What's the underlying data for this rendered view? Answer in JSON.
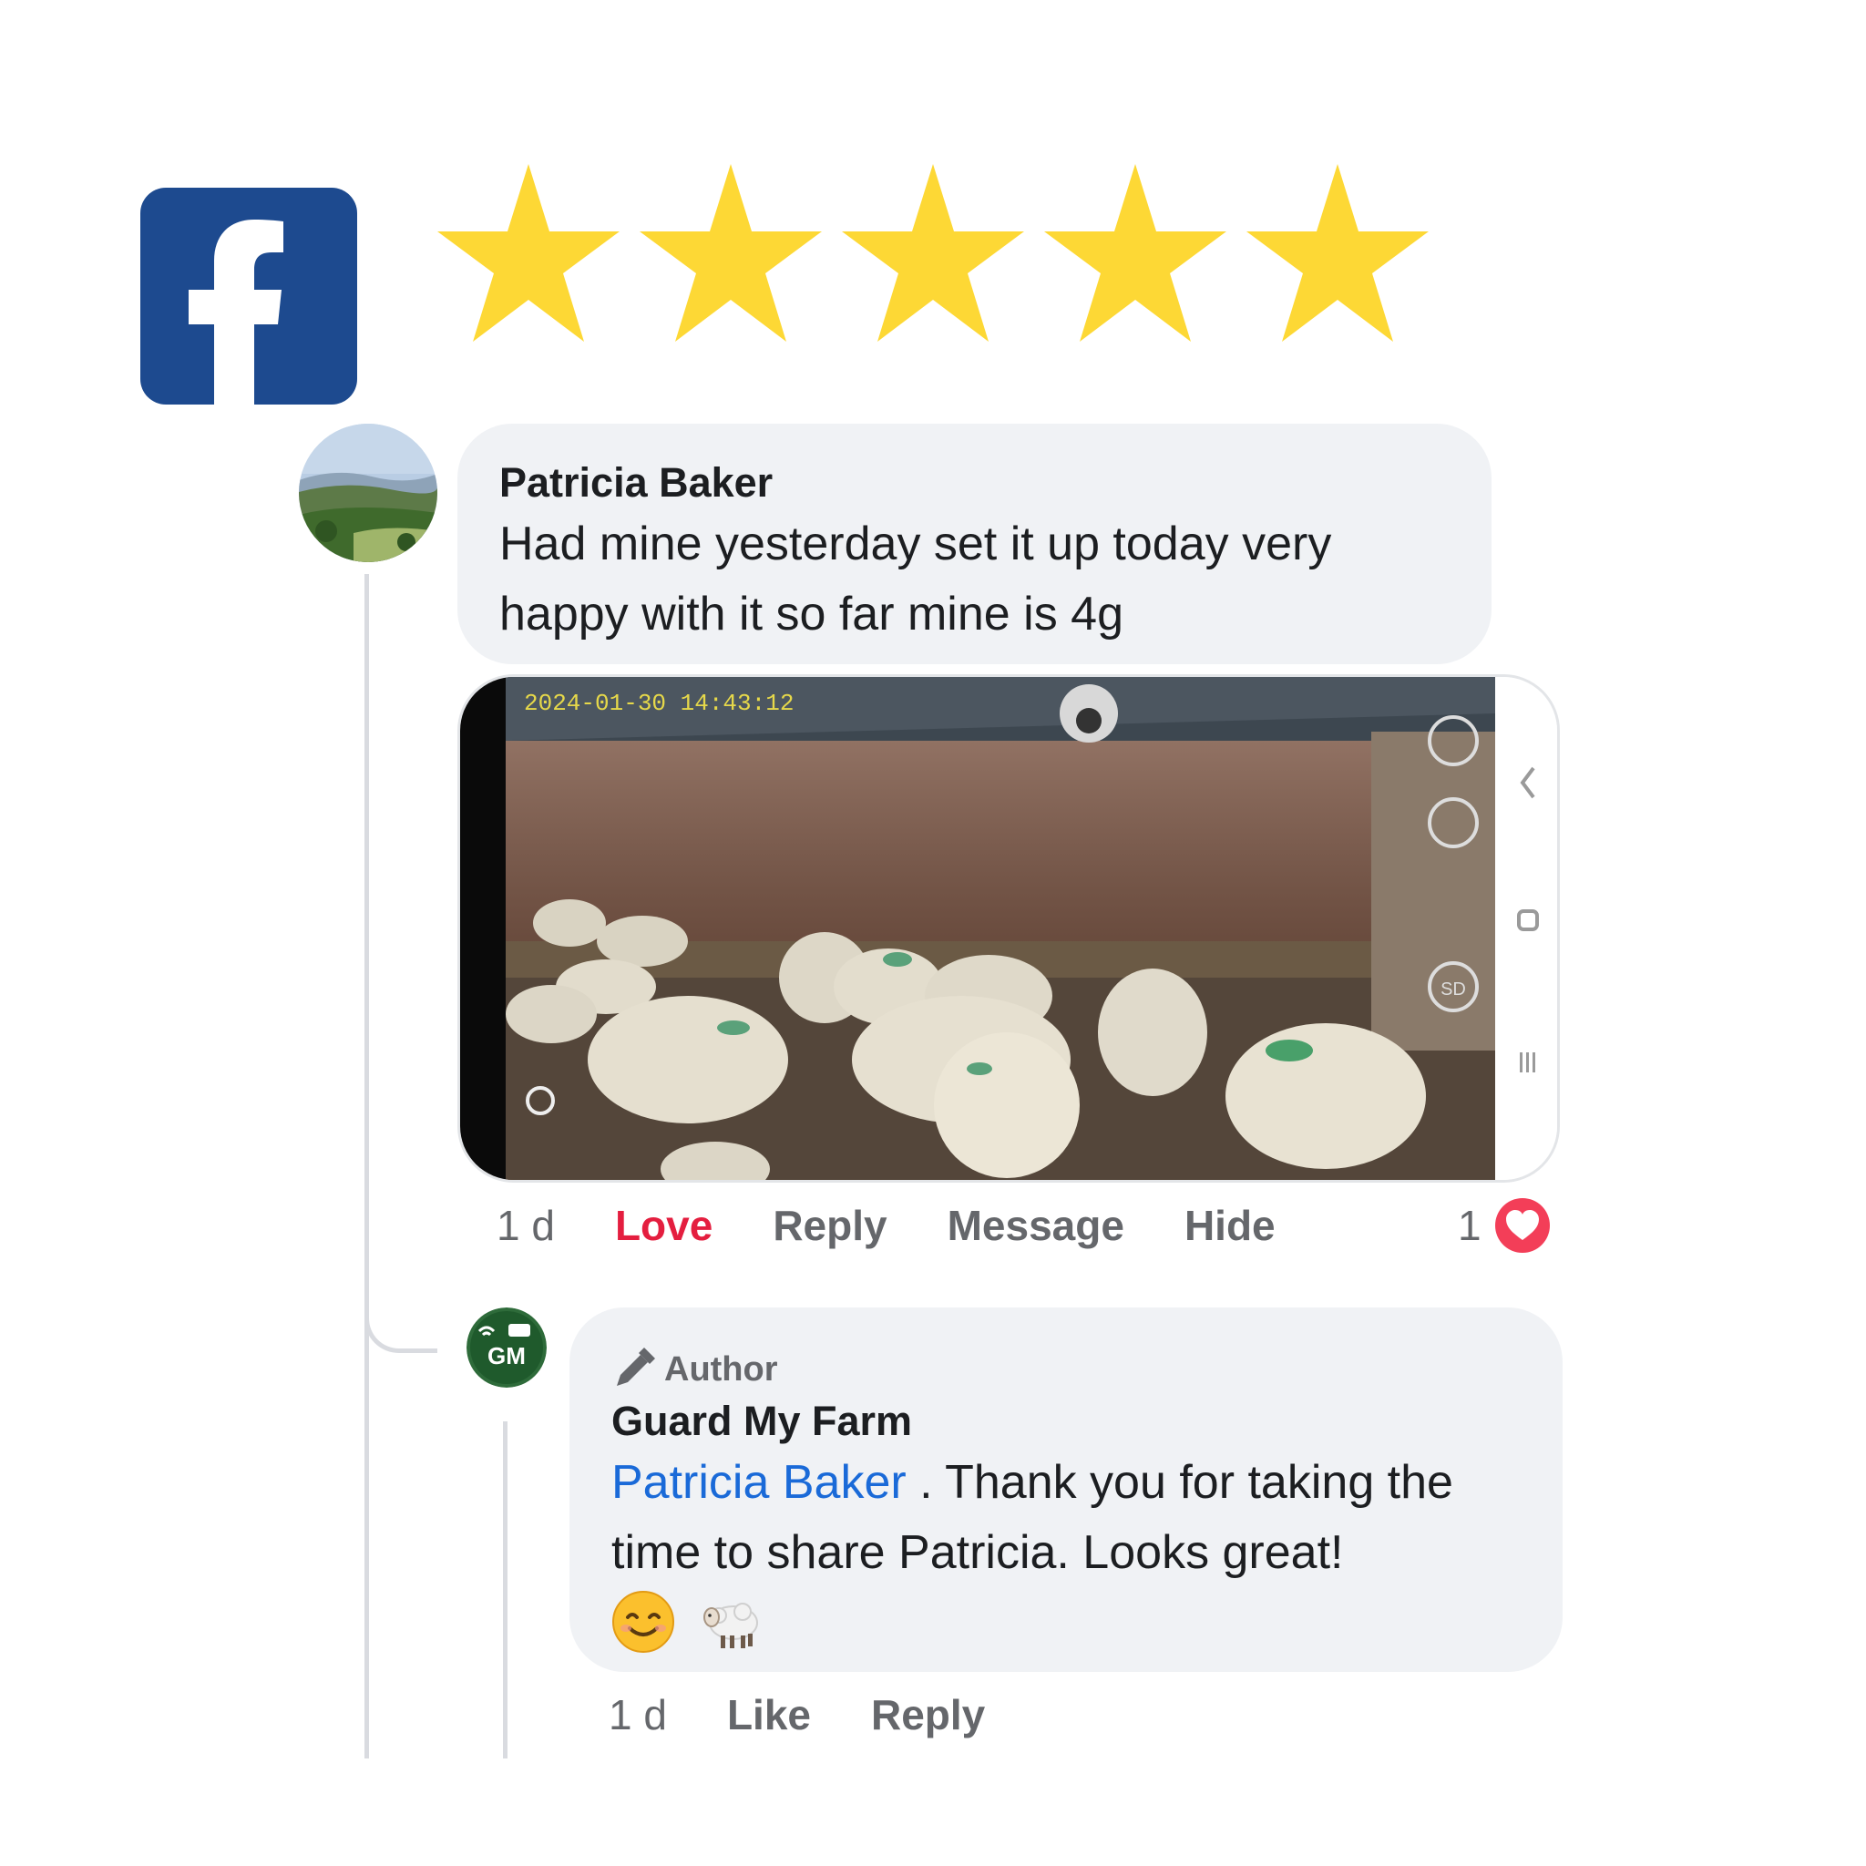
{
  "rating": {
    "stars_filled": 5,
    "stars_total": 5,
    "star_color": "#fdd835"
  },
  "brand": {
    "logo": "facebook-logo",
    "logo_color": "#1d4a8f"
  },
  "comment": {
    "author": "Patricia Baker",
    "text": "Had mine yesterday  set it up today very happy with it so far mine is 4g",
    "attachment": {
      "timestamp_overlay": "2024-01-30  14:43:12",
      "overlay_badge": "SD"
    },
    "actions": {
      "time": "1 d",
      "love": "Love",
      "reply": "Reply",
      "message": "Message",
      "hide": "Hide"
    },
    "reaction_count": "1",
    "reaction_icon": "heart-icon",
    "accent_love": "#e41e3f"
  },
  "reply": {
    "badge": "Author",
    "author": "Guard My Farm",
    "avatar_initials": "GM",
    "mention": "Patricia Baker",
    "text": " . Thank you for taking the time to share Patricia. Looks great!",
    "emojis": [
      "smiling-face-emoji",
      "sheep-emoji"
    ],
    "actions": {
      "time": "1 d",
      "like": "Like",
      "reply": "Reply"
    },
    "mention_color": "#1a6ad8"
  }
}
